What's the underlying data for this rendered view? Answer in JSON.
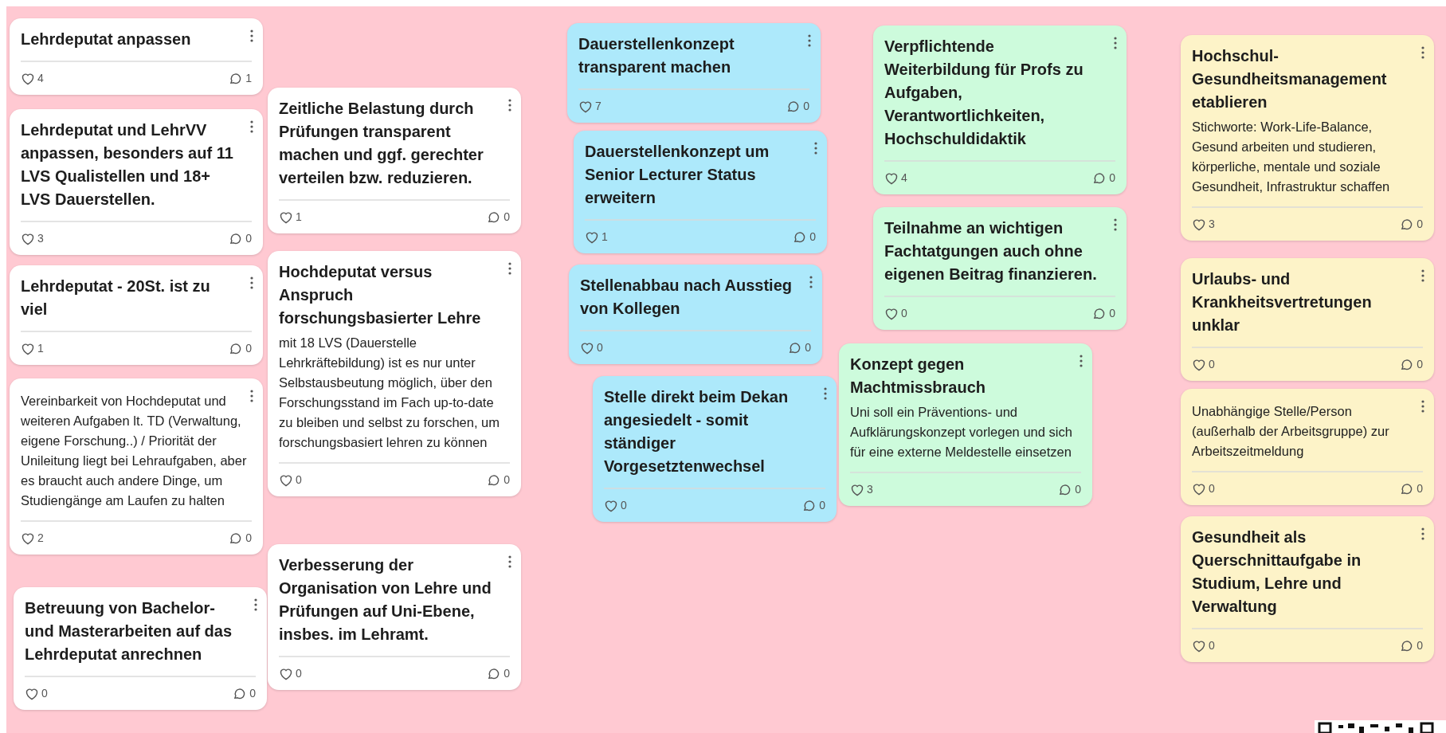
{
  "cards": [
    {
      "title": "Lehrdeputat anpassen",
      "color": "#ffffff",
      "likes": "4",
      "comments": "1"
    },
    {
      "title": "Lehrdeputat und LehrVV anpassen, besonders auf 11 LVS Qualistellen und 18+ LVS Dauerstellen.",
      "color": "#ffffff",
      "likes": "3",
      "comments": "0"
    },
    {
      "title": "Lehrdeputat - 20St. ist zu viel",
      "color": "#ffffff",
      "likes": "1",
      "comments": "0"
    },
    {
      "body": "Vereinbarkeit von Hochdeputat und weiteren Aufgaben lt. TD (Verwaltung, eigene Forschung..) / Priorität der Unileitung liegt bei Lehraufgaben, aber es braucht auch andere Dinge, um Studiengänge am Laufen zu halten",
      "color": "#ffffff",
      "likes": "2",
      "comments": "0"
    },
    {
      "title": "Betreuung von Bachelor- und Masterarbeiten auf das Lehrdeputat anrechnen",
      "color": "#ffffff",
      "likes": "0",
      "comments": "0"
    },
    {
      "title": "Zeitliche Belastung durch Prüfungen transparent machen und ggf. gerechter verteilen bzw. reduzieren.",
      "color": "#ffffff",
      "likes": "1",
      "comments": "0"
    },
    {
      "title": "Hochdeputat versus Anspruch forschungsbasierter Lehre",
      "body": "mit 18 LVS (Dauerstelle Lehrkräftebildung) ist es nur unter Selbstausbeutung möglich, über den Forschungsstand im Fach up-to-date zu bleiben und selbst zu forschen, um forschungsbasiert lehren zu können",
      "color": "#ffffff",
      "likes": "0",
      "comments": "0"
    },
    {
      "title": "Verbesserung der Organisation von Lehre und Prüfungen auf Uni-Ebene, insbes. im Lehramt.",
      "color": "#ffffff",
      "likes": "0",
      "comments": "0"
    },
    {
      "title": "Dauerstellenkonzept transparent machen",
      "color": "#ade9fb",
      "likes": "7",
      "comments": "0"
    },
    {
      "title": "Dauerstellenkonzept um Senior Lecturer Status erweitern",
      "color": "#ade9fb",
      "likes": "1",
      "comments": "0"
    },
    {
      "title": "Stellenabbau nach Ausstieg von Kollegen",
      "color": "#ade9fb",
      "likes": "0",
      "comments": "0"
    },
    {
      "title": "Stelle direkt beim Dekan angesiedelt - somit ständiger Vorgesetztenwechsel",
      "color": "#ade9fb",
      "likes": "0",
      "comments": "0"
    },
    {
      "title": "Verpflichtende Weiterbildung für Profs zu Aufgaben, Verantwortlichkeiten, Hochschuldidaktik",
      "color": "#cdfbdc",
      "likes": "4",
      "comments": "0"
    },
    {
      "title": "Teilnahme an wichtigen Fachtatgungen auch ohne eigenen Beitrag finanzieren.",
      "color": "#cdfbdc",
      "likes": "0",
      "comments": "0"
    },
    {
      "title": "Konzept gegen Machtmissbrauch",
      "body": "Uni soll ein Präventions- und Aufklärungskonzept vorlegen und sich für eine externe Meldestelle einsetzen",
      "color": "#cdfbdc",
      "likes": "3",
      "comments": "0"
    },
    {
      "title": "Hochschul-Gesundheitsmanagement etablieren",
      "body": "Stichworte: Work-Life-Balance, Gesund arbeiten und studieren, körperliche, mentale und soziale Gesundheit, Infrastruktur schaffen",
      "color": "#fdf3c8",
      "likes": "3",
      "comments": "0"
    },
    {
      "title": "Urlaubs- und Krankheitsvertretungen unklar",
      "color": "#fdf3c8",
      "likes": "0",
      "comments": "0"
    },
    {
      "body": "Unabhängige Stelle/Person (außerhalb der Arbeitsgruppe) zur Arbeitszeitmeldung",
      "color": "#fdf3c8",
      "likes": "0",
      "comments": "0"
    },
    {
      "title": "Gesundheit als Querschnittaufgabe in Studium, Lehre und Verwaltung",
      "color": "#fdf3c8",
      "likes": "0",
      "comments": "0"
    }
  ]
}
